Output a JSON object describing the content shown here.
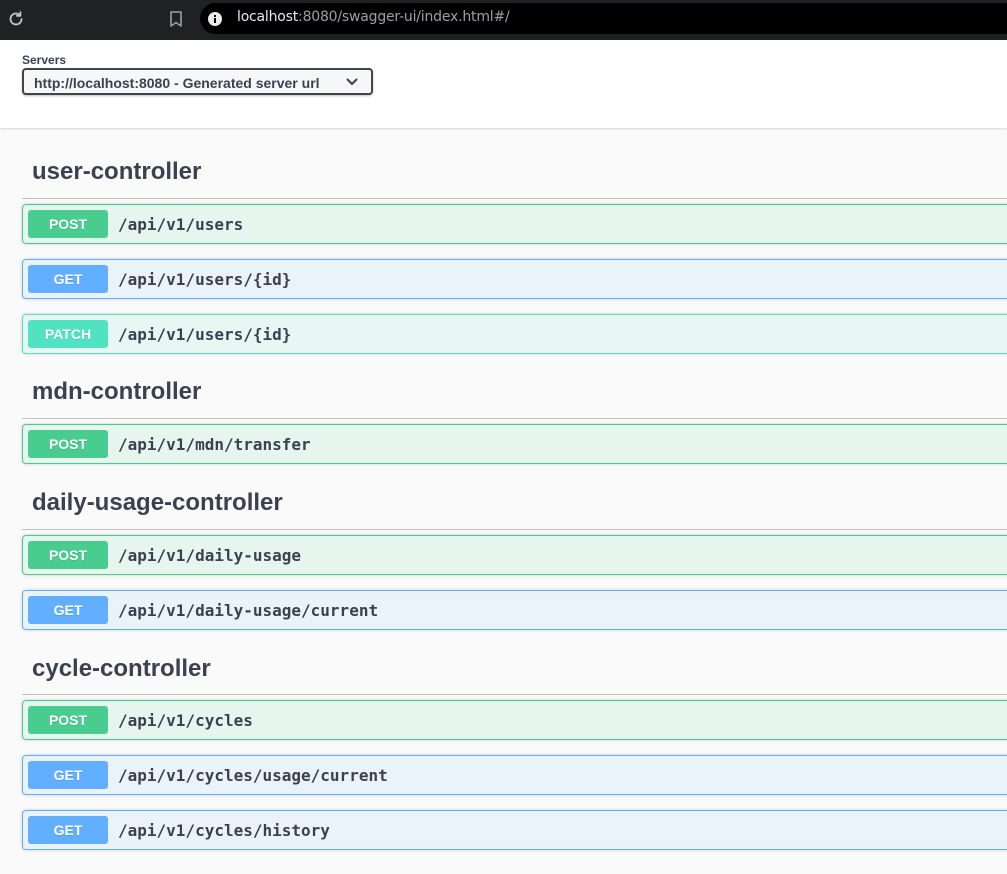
{
  "browser": {
    "url_host": "localhost",
    "url_rest": ":8080/swagger-ui/index.html#/"
  },
  "servers": {
    "label": "Servers",
    "selected": "http://localhost:8080 - Generated server url"
  },
  "tags": [
    {
      "name": "user-controller",
      "operations": [
        {
          "method": "POST",
          "path": "/api/v1/users"
        },
        {
          "method": "GET",
          "path": "/api/v1/users/{id}"
        },
        {
          "method": "PATCH",
          "path": "/api/v1/users/{id}"
        }
      ]
    },
    {
      "name": "mdn-controller",
      "operations": [
        {
          "method": "POST",
          "path": "/api/v1/mdn/transfer"
        }
      ]
    },
    {
      "name": "daily-usage-controller",
      "operations": [
        {
          "method": "POST",
          "path": "/api/v1/daily-usage"
        },
        {
          "method": "GET",
          "path": "/api/v1/daily-usage/current"
        }
      ]
    },
    {
      "name": "cycle-controller",
      "operations": [
        {
          "method": "POST",
          "path": "/api/v1/cycles"
        },
        {
          "method": "GET",
          "path": "/api/v1/cycles/usage/current"
        },
        {
          "method": "GET",
          "path": "/api/v1/cycles/history"
        }
      ]
    }
  ],
  "colors": {
    "post": "#49cc90",
    "get": "#61affe",
    "patch": "#50e3c2",
    "text": "#3b4151"
  }
}
